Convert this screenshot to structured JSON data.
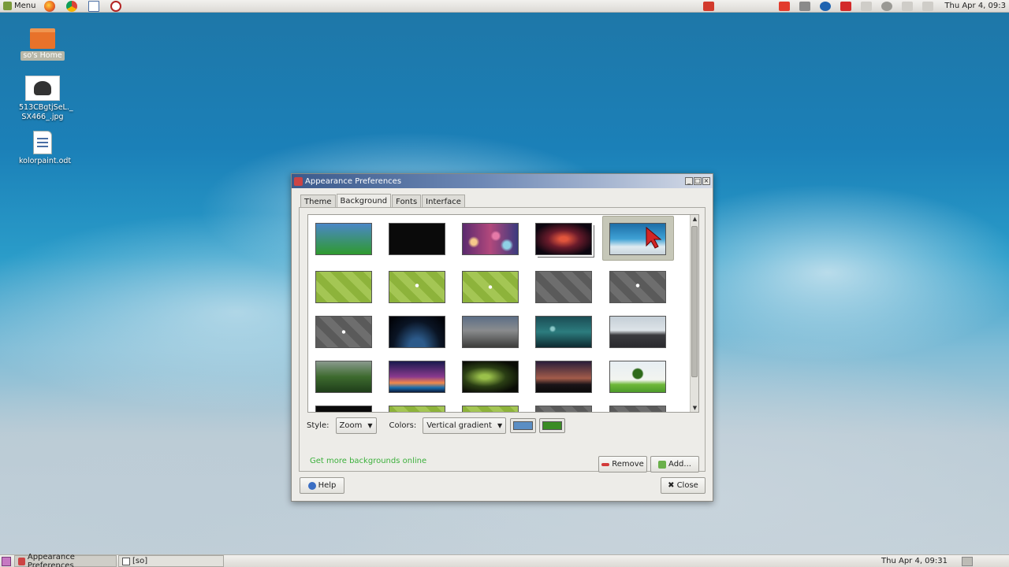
{
  "top_panel": {
    "menu_label": "Menu",
    "clock": "Thu Apr  4, 09:3",
    "launchers": [
      "firefox-icon",
      "chrome-icon",
      "text-editor-icon",
      "app-icon"
    ],
    "tray_icons": [
      "power-icon",
      "anydesk-icon",
      "network-icon",
      "hp-icon",
      "record-icon",
      "bluetooth-icon",
      "settings-icon",
      "network-status-icon",
      "volume-icon"
    ]
  },
  "desktop": {
    "icons": [
      {
        "label": "so's Home",
        "icon": "home-folder-icon"
      },
      {
        "label": "513CBgtjSeL._SX466_.jpg",
        "label_line1": "513CBgtjSeL._",
        "label_line2": "SX466_.jpg",
        "icon": "image-file-icon"
      },
      {
        "label": "kolorpaint.odt",
        "icon": "document-file-icon"
      }
    ]
  },
  "window": {
    "title": "Appearance Preferences",
    "tabs": [
      {
        "label": "Theme",
        "active": false
      },
      {
        "label": "Background",
        "active": true
      },
      {
        "label": "Fonts",
        "active": false
      },
      {
        "label": "Interface",
        "active": false
      }
    ],
    "backgrounds_selected_index": 4,
    "style_label": "Style:",
    "style_value": "Zoom",
    "colors_label": "Colors:",
    "colors_value": "Vertical gradient",
    "primary_color": "#5b8ec4",
    "secondary_color": "#3a8c24",
    "online_link": "Get more backgrounds online",
    "remove_label": "Remove",
    "add_label": "Add...",
    "help_label": "Help",
    "close_label": "Close"
  },
  "bottom_panel": {
    "tasks": [
      {
        "label": "Appearance Preferences",
        "active": true
      },
      {
        "label": "[so]",
        "active": false
      }
    ],
    "clock": "Thu Apr  4, 09:31"
  }
}
